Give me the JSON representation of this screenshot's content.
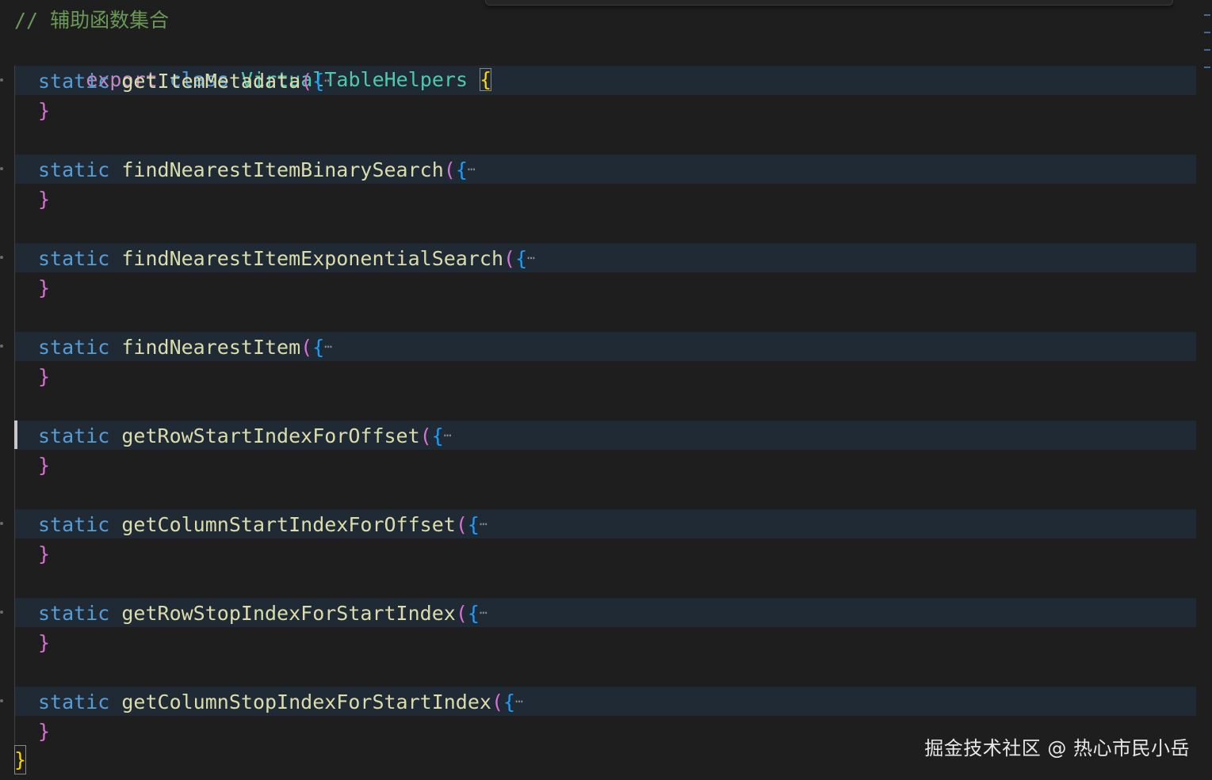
{
  "editor": {
    "comment": "// 辅助函数集合",
    "class_decl": {
      "export_kw": "export",
      "class_kw": "class",
      "class_name": "VirtualTableHelpers",
      "open_brace": "{"
    },
    "methods": [
      {
        "static_kw": "static",
        "name": "getItemMetadata",
        "paren": "(",
        "brace": "{",
        "ellipsis": "⋯",
        "close_brace": "}"
      },
      {
        "static_kw": "static",
        "name": "findNearestItemBinarySearch",
        "paren": "(",
        "brace": "{",
        "ellipsis": "⋯",
        "close_brace": "}"
      },
      {
        "static_kw": "static",
        "name": "findNearestItemExponentialSearch",
        "paren": "(",
        "brace": "{",
        "ellipsis": "⋯",
        "close_brace": "}"
      },
      {
        "static_kw": "static",
        "name": "findNearestItem",
        "paren": "(",
        "brace": "{",
        "ellipsis": "⋯",
        "close_brace": "}"
      },
      {
        "static_kw": "static",
        "name": "getRowStartIndexForOffset",
        "paren": "(",
        "brace": "{",
        "ellipsis": "⋯",
        "close_brace": "}"
      },
      {
        "static_kw": "static",
        "name": "getColumnStartIndexForOffset",
        "paren": "(",
        "brace": "{",
        "ellipsis": "⋯",
        "close_brace": "}"
      },
      {
        "static_kw": "static",
        "name": "getRowStopIndexForStartIndex",
        "paren": "(",
        "brace": "{",
        "ellipsis": "⋯",
        "close_brace": "}"
      },
      {
        "static_kw": "static",
        "name": "getColumnStopIndexForStartIndex",
        "paren": "(",
        "brace": "{",
        "ellipsis": "⋯",
        "close_brace": "}"
      }
    ],
    "class_close_brace": "}"
  },
  "watermark": "掘金技术社区 @ 热心市民小岳",
  "colors": {
    "background": "#1e1e1e",
    "comment": "#6a9955",
    "keyword": "#c586c0",
    "storage": "#569cd6",
    "class_name": "#4ec9b0",
    "function": "#dcdcaa",
    "paren": "#da70d6",
    "brace": "#179fff",
    "brace_gold": "#ffd700",
    "folded_line_bg": "#1f2a35"
  }
}
